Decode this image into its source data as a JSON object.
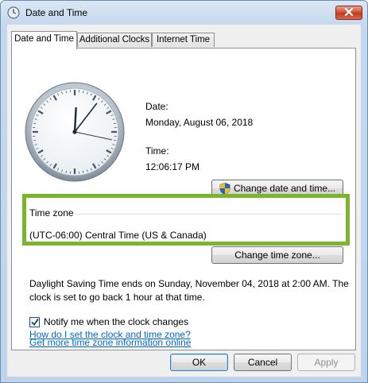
{
  "window": {
    "title": "Date and Time"
  },
  "tabs": [
    {
      "label": "Date and Time",
      "active": true
    },
    {
      "label": "Additional Clocks",
      "active": false
    },
    {
      "label": "Internet Time",
      "active": false
    }
  ],
  "datetime": {
    "date_label": "Date:",
    "date_value": "Monday, August 06, 2018",
    "time_label": "Time:",
    "time_value": "12:06:17 PM",
    "clock_time": {
      "hour": 12,
      "minute": 6,
      "second": 17
    },
    "change_button": "Change date and time..."
  },
  "timezone": {
    "section_label": "Time zone",
    "value": "(UTC-06:00) Central Time (US & Canada)",
    "change_button": "Change time zone...",
    "highlight_color": "#7ab52b"
  },
  "dst": {
    "line1": "Daylight Saving Time ends on Sunday, November 04, 2018 at 2:00 AM. The",
    "line2": "clock is set to go back 1 hour at that time."
  },
  "notify": {
    "label": "Notify me when the clock changes",
    "checked": true
  },
  "links": {
    "more_info": "Get more time zone information online",
    "how_to": "How do I set the clock and time zone?"
  },
  "footer": {
    "ok": "OK",
    "cancel": "Cancel",
    "apply": "Apply"
  },
  "icons": {
    "title": "clock-icon",
    "close": "close-icon",
    "shield": "uac-shield-icon",
    "check": "checkmark-icon"
  },
  "colors": {
    "link": "#0066cc",
    "close_button": "#c23a20"
  }
}
